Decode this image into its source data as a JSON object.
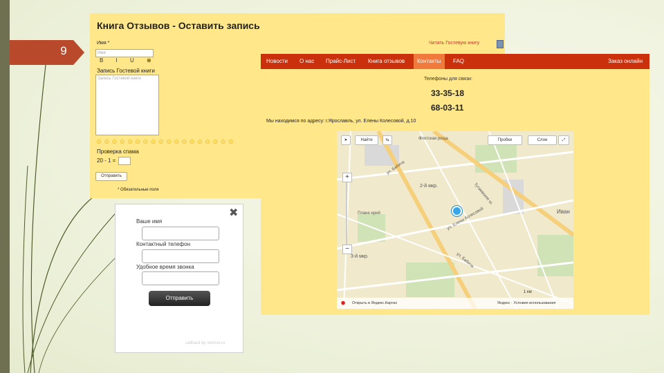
{
  "slide": {
    "number": "9"
  },
  "guestbook": {
    "title": "Книга Отзывов - Оставить запись",
    "read_link": "Читать Гостевую книгу",
    "name_label": "Имя *",
    "name_placeholder": "Имя",
    "format_buttons": "B I U ⊕",
    "entry_label": "Запись Гостевой книги",
    "entry_placeholder": "Запись Гостевой книги",
    "smileys": "☺☺☺☺☺☺☺☺☺☺☺☺☺☺☺☺☺☺",
    "spam_label": "Проверка спама",
    "captcha_question": "20 - 1 =",
    "submit_label": "Отправить",
    "required_note": "* Обязательные поля"
  },
  "contacts": {
    "nav": [
      "Новости",
      "О нас",
      "Прайс-Лист",
      "Книга отзывов",
      "Контакты",
      "FAQ"
    ],
    "nav_active": "Контакты",
    "nav_right": "Заказ онлайн",
    "phones_label": "Телефоны для связи:",
    "phones": [
      "33-35-18",
      "68-03-11"
    ],
    "address": "Мы находимся по адресу: г.Ярославль, ул. Елены Колесовой, д.10",
    "map": {
      "find_button": "Найти",
      "traffic_button": "Пробки",
      "layers_button": "Слои",
      "labels": [
        "Флотская роща",
        "2-й мкр.",
        "Плане ерий",
        "3-й мкр.",
        "Иван",
        "ул. Бабича",
        "Тутаевское ш.",
        "ул. Елены Колесовой",
        "ул. Бабича"
      ],
      "footer_left": "Открыть в Яндекс.Картах",
      "footer_right": "Яндекс · Условия использования",
      "scale": "1 км"
    }
  },
  "callback": {
    "name_label": "Ваше имя",
    "phone_label": "Контактный телефон",
    "time_label": "Удобное время звонка",
    "submit_label": "Отправить",
    "footer": "callback by sbomsi.ru"
  }
}
